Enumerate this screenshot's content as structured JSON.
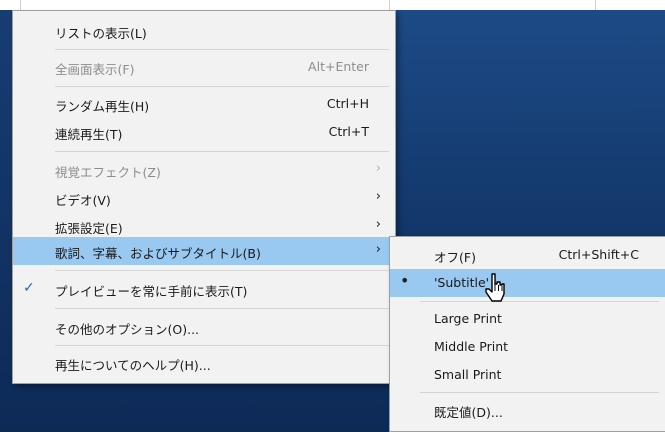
{
  "main_menu": {
    "items": [
      {
        "label": "リストの表示(L)"
      },
      {
        "label": "全画面表示(F)",
        "shortcut": "Alt+Enter"
      },
      {
        "label": "ランダム再生(H)",
        "shortcut": "Ctrl+H"
      },
      {
        "label": "連続再生(T)",
        "shortcut": "Ctrl+T"
      },
      {
        "label": "視覚エフェクト(Z)",
        "arrow": "›"
      },
      {
        "label": "ビデオ(V)",
        "arrow": "›"
      },
      {
        "label": "拡張設定(E)",
        "arrow": "›"
      },
      {
        "label": "歌詞、字幕、およびサブタイトル(B)",
        "arrow": "›"
      },
      {
        "label": "プレイビューを常に手前に表示(T)",
        "check": "✓"
      },
      {
        "label": "その他のオプション(O)..."
      },
      {
        "label": "再生についてのヘルプ(H)..."
      }
    ]
  },
  "sub_menu": {
    "items": [
      {
        "label": "オフ(F)",
        "shortcut": "Ctrl+Shift+C"
      },
      {
        "label": "'Subtitle'",
        "bullet": "•"
      },
      {
        "label": "Large Print"
      },
      {
        "label": "Middle Print"
      },
      {
        "label": "Small Print"
      },
      {
        "label": "既定値(D)..."
      }
    ]
  },
  "colors": {
    "menu_bg": "#f2f2f2",
    "hover_bg": "#99c8f0",
    "disabled_text": "#8d8d8d",
    "desktop_bg": "#0f2a52"
  },
  "icons": {
    "check": "check-icon",
    "bullet": "bullet-icon",
    "submenu_arrow": "chevron-right-icon",
    "cursor": "mouse-pointer-icon"
  }
}
